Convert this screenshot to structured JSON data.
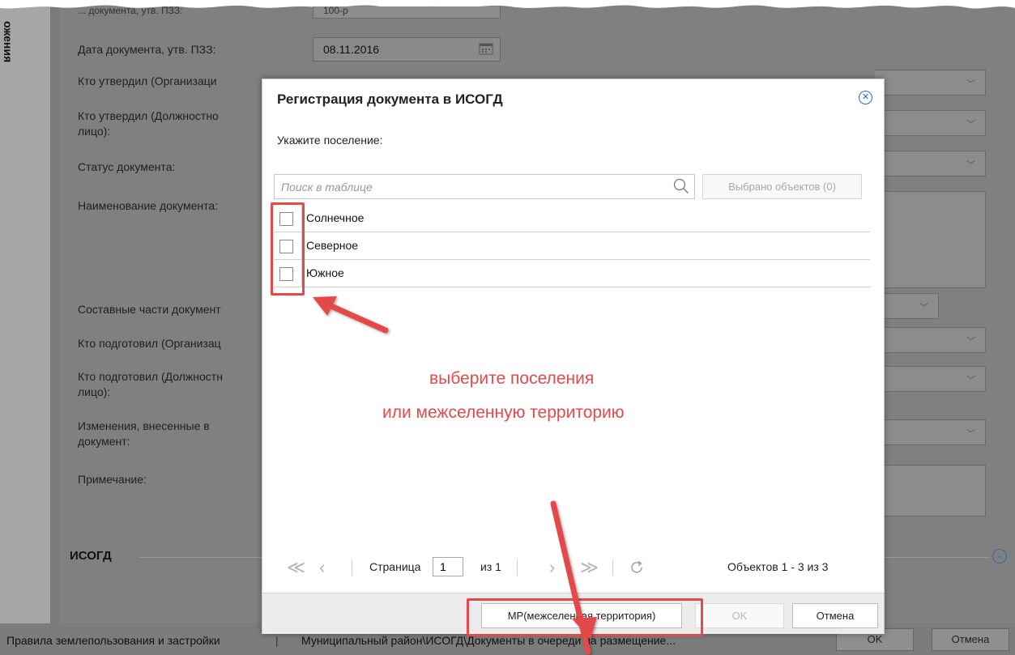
{
  "background_form": {
    "side_tab": "ожения",
    "top_field_partial": "100-р",
    "top_label_partial": "... документа, утв. ПЗЗ:",
    "rows": [
      {
        "label": "Дата документа, утв. ПЗЗ:"
      },
      {
        "label": "Кто утвердил (Организаци"
      },
      {
        "label": "Кто утвердил (Должностно",
        "label2": "лицо):"
      },
      {
        "label": "Статус документа:"
      },
      {
        "label": "Наименование документа:"
      },
      {
        "label": "Составные части документ"
      },
      {
        "label": "Кто подготовил (Организац"
      },
      {
        "label": "Кто подготовил (Должностн",
        "label2": "лицо):"
      },
      {
        "label": "Изменения, внесенные в",
        "label2": "документ:"
      },
      {
        "label": "Примечание:"
      }
    ],
    "date_value": "08.11.2016",
    "section_title": "ИСОГД"
  },
  "statusbar": {
    "left_text": "Правила землепользования и застройки",
    "path_text": "Муниципальный район\\ИСОГД\\Документы в очереди на размещение...",
    "ok_label": "OK",
    "cancel_label": "Отмена"
  },
  "modal": {
    "title": "Регистрация документа в ИСОГД",
    "prompt": "Укажите поселение:",
    "search_placeholder": "Поиск в таблице",
    "selected_label": "Выбрано объектов (0)",
    "rows": [
      {
        "name": "Солнечное",
        "checked": false
      },
      {
        "name": "Северное",
        "checked": false
      },
      {
        "name": "Южное",
        "checked": false
      }
    ],
    "pager": {
      "page_label": "Страница",
      "page_value": "1",
      "of_label": "из 1",
      "summary": "Объектов 1 - 3 из 3"
    },
    "footer": {
      "mr_label": "МР(межселенная территория)",
      "ok_label": "OK",
      "cancel_label": "Отмена"
    }
  },
  "annotation": {
    "line1": "выберите поселения",
    "line2": "или межселенную территорию",
    "color": "#e34a4a"
  }
}
